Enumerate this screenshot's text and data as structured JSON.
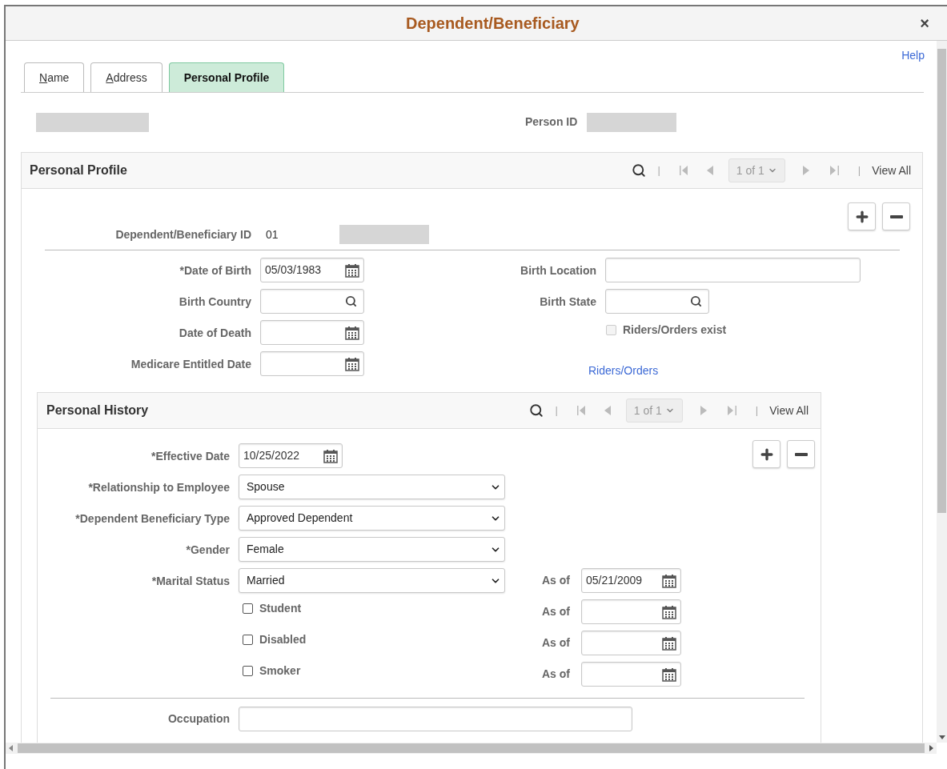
{
  "window": {
    "title": "Dependent/Beneficiary",
    "close": "×"
  },
  "help_link": "Help",
  "tabs": [
    {
      "label": "Name",
      "selected": false,
      "access_key_underlined": true
    },
    {
      "label": "Address",
      "selected": false,
      "access_key_underlined": true
    },
    {
      "label": "Personal Profile",
      "selected": true,
      "access_key_underlined": false
    }
  ],
  "person_id": {
    "label": "Person ID"
  },
  "personal_profile": {
    "title": "Personal Profile",
    "nav": {
      "separator": "|",
      "page_select": "1 of 1",
      "view_all": "View All"
    },
    "dependent_id": {
      "label": "Dependent/Beneficiary ID",
      "value": "01"
    },
    "left_fields": [
      {
        "kind": "date",
        "label": "*Date of Birth",
        "value": "05/03/1983"
      },
      {
        "kind": "lookup",
        "label": "Birth Country"
      },
      {
        "kind": "date",
        "label": "Date of Death"
      },
      {
        "kind": "date",
        "label": "Medicare Entitled Date"
      }
    ],
    "right_fields": [
      {
        "kind": "text",
        "label": "Birth Location"
      },
      {
        "kind": "lookup",
        "label": "Birth State"
      },
      {
        "kind": "checkbox",
        "label": "Riders/Orders exist",
        "checked": false,
        "disabled": true
      },
      {
        "kind": "link",
        "label": "Riders/Orders"
      }
    ]
  },
  "personal_history": {
    "title": "Personal History",
    "nav": {
      "separator": "|",
      "page_select": "1 of 1",
      "view_all": "View All"
    },
    "fields": [
      {
        "kind": "date",
        "label": "*Effective Date",
        "value": "10/25/2022"
      },
      {
        "kind": "select",
        "label": "*Relationship to Employee",
        "value": "Spouse"
      },
      {
        "kind": "select",
        "label": "*Dependent Beneficiary Type",
        "value": "Approved Dependent"
      },
      {
        "kind": "select",
        "label": "*Gender",
        "value": "Female"
      },
      {
        "kind": "select",
        "label": "*Marital Status",
        "value": "Married",
        "as_of": {
          "label": "As of",
          "value": "05/21/2009"
        }
      },
      {
        "kind": "checkbox",
        "label": "Student",
        "checked": false,
        "as_of": {
          "label": "As of"
        }
      },
      {
        "kind": "checkbox",
        "label": "Disabled",
        "checked": false,
        "as_of": {
          "label": "As of"
        }
      },
      {
        "kind": "checkbox",
        "label": "Smoker",
        "checked": false,
        "as_of": {
          "label": "As of"
        }
      }
    ],
    "occupation": {
      "label": "Occupation"
    }
  }
}
